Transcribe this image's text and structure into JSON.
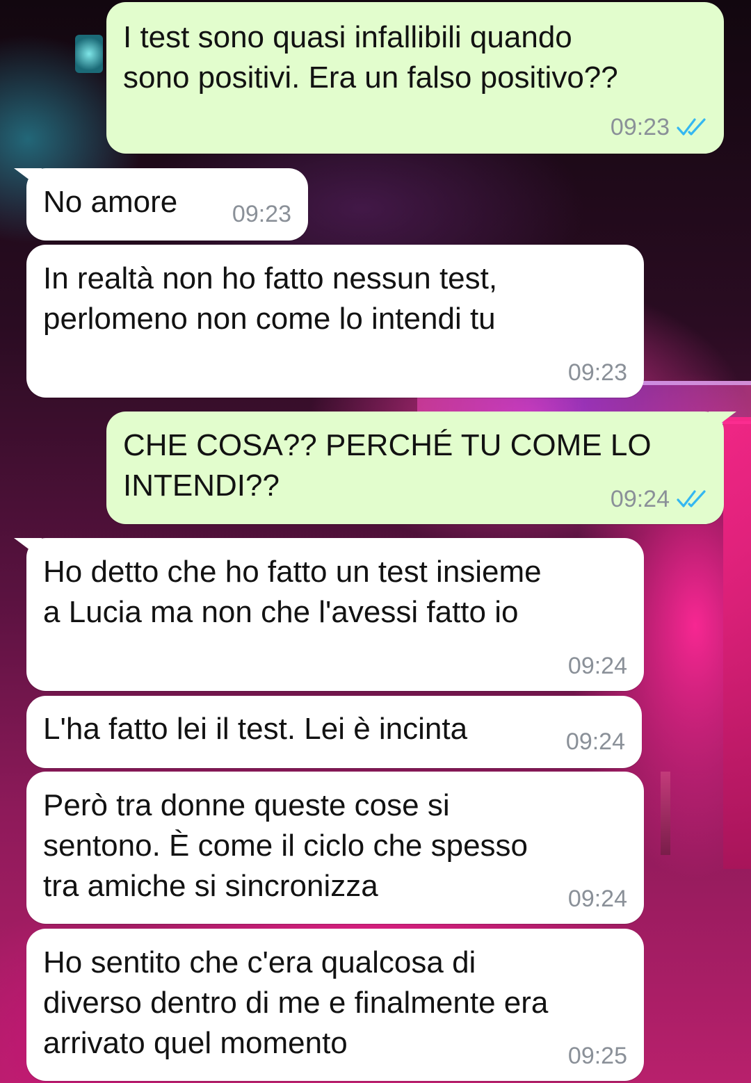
{
  "theme": {
    "outgoing_bubble_color": "#e2fdcd",
    "incoming_bubble_color": "#ffffff",
    "timestamp_color": "#8a9098",
    "read_ticks_color": "#34b7f1"
  },
  "messages": [
    {
      "direction": "outgoing",
      "text": "I test sono quasi infallibili quando\nsono positivi. Era un falso positivo??",
      "time": "09:23",
      "status": "read",
      "status_icon": "double-check-icon"
    },
    {
      "direction": "incoming",
      "text": "No amore",
      "time": "09:23"
    },
    {
      "direction": "incoming",
      "text": "In realtà non ho fatto nessun test,\nperlomeno non come lo intendi tu",
      "time": "09:23"
    },
    {
      "direction": "outgoing",
      "text": "CHE COSA?? PERCHÉ TU COME LO\nINTENDI??",
      "time": "09:24",
      "status": "read",
      "status_icon": "double-check-icon"
    },
    {
      "direction": "incoming",
      "text": "Ho detto che ho fatto un test insieme\na Lucia ma non che l'avessi fatto io",
      "time": "09:24"
    },
    {
      "direction": "incoming",
      "text": "L'ha fatto lei il test. Lei è incinta",
      "time": "09:24"
    },
    {
      "direction": "incoming",
      "text": "Però tra donne queste cose si\nsentono. È come il ciclo che spesso\ntra amiche si sincronizza",
      "time": "09:24"
    },
    {
      "direction": "incoming",
      "text": "Ho sentito che c'era qualcosa di\ndiverso dentro di me e finalmente era\narrivato quel momento",
      "time": "09:25"
    }
  ]
}
